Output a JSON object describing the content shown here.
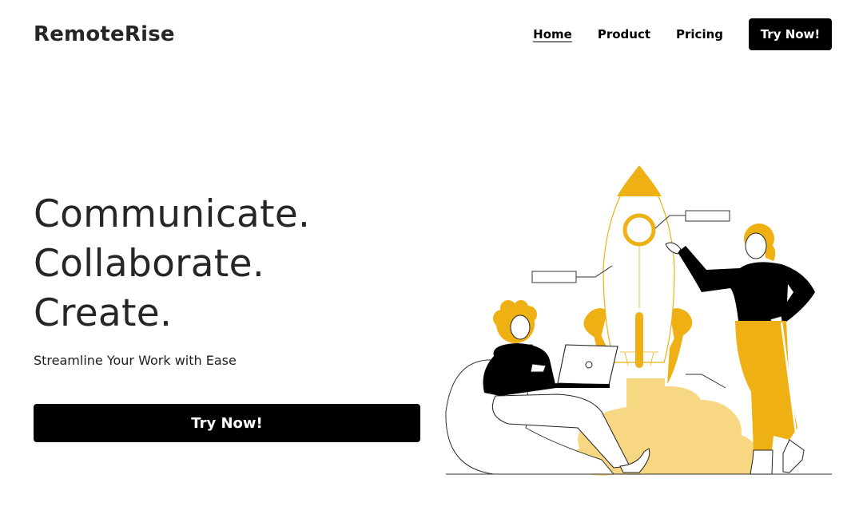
{
  "header": {
    "logo": "RemoteRise",
    "nav": [
      {
        "label": "Home",
        "active": true
      },
      {
        "label": "Product",
        "active": false
      },
      {
        "label": "Pricing",
        "active": false
      }
    ],
    "cta_label": "Try Now!"
  },
  "hero": {
    "headline": [
      "Communicate.",
      "Collaborate.",
      "Create."
    ],
    "subheadline": "Streamline Your Work with Ease",
    "cta_label": "Try Now!"
  },
  "illustration": {
    "icon": "rocket-launch-team-illustration",
    "accent_color": "#EFB014",
    "smoke_color": "#F7D782",
    "ink_color": "#000000"
  }
}
